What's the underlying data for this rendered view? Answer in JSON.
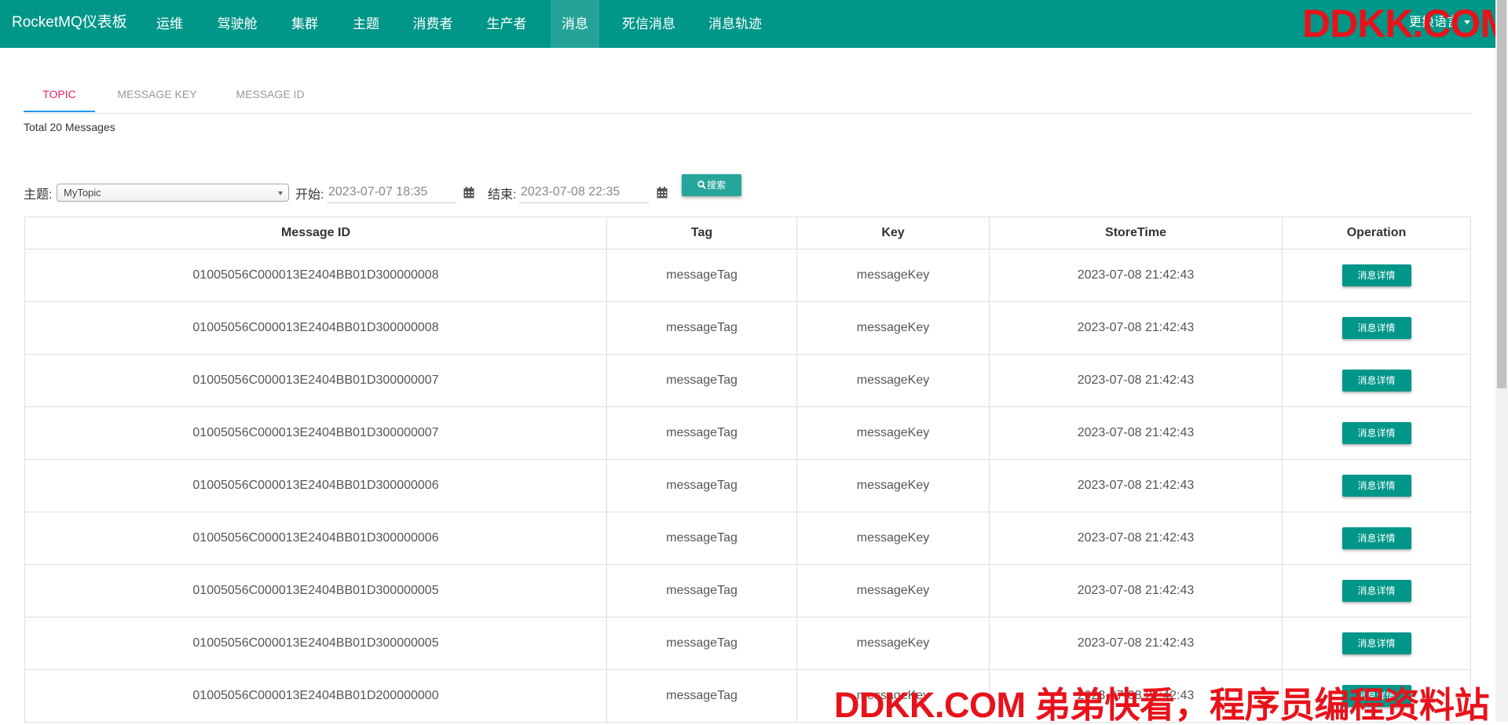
{
  "navbar": {
    "brand": "RocketMQ仪表板",
    "items": [
      {
        "label": "运维"
      },
      {
        "label": "驾驶舱"
      },
      {
        "label": "集群"
      },
      {
        "label": "主题"
      },
      {
        "label": "消费者"
      },
      {
        "label": "生产者"
      },
      {
        "label": "消息"
      },
      {
        "label": "死信消息"
      },
      {
        "label": "消息轨迹"
      }
    ],
    "active_item": "消息",
    "language_label": "更换语言"
  },
  "watermark": {
    "top": "DDKK.COM",
    "bottom": "DDKK.COM 弟弟快看，程序员编程资料站"
  },
  "tabs": [
    {
      "label": "TOPIC"
    },
    {
      "label": "MESSAGE KEY"
    },
    {
      "label": "MESSAGE ID"
    }
  ],
  "active_tab": "TOPIC",
  "total_text": "Total 20 Messages",
  "filters": {
    "topic_label": "主题:",
    "topic_value": "MyTopic",
    "start_label": "开始:",
    "start_value": "2023-07-07 18:35",
    "end_label": "结束:",
    "end_value": "2023-07-08 22:35",
    "search_label": "搜索"
  },
  "table": {
    "headers": [
      "Message ID",
      "Tag",
      "Key",
      "StoreTime",
      "Operation"
    ],
    "detail_label": "消息详情",
    "rows": [
      {
        "id": "01005056C000013E2404BB01D300000008",
        "tag": "messageTag",
        "key": "messageKey",
        "time": "2023-07-08 21:42:43"
      },
      {
        "id": "01005056C000013E2404BB01D300000008",
        "tag": "messageTag",
        "key": "messageKey",
        "time": "2023-07-08 21:42:43"
      },
      {
        "id": "01005056C000013E2404BB01D300000007",
        "tag": "messageTag",
        "key": "messageKey",
        "time": "2023-07-08 21:42:43"
      },
      {
        "id": "01005056C000013E2404BB01D300000007",
        "tag": "messageTag",
        "key": "messageKey",
        "time": "2023-07-08 21:42:43"
      },
      {
        "id": "01005056C000013E2404BB01D300000006",
        "tag": "messageTag",
        "key": "messageKey",
        "time": "2023-07-08 21:42:43"
      },
      {
        "id": "01005056C000013E2404BB01D300000006",
        "tag": "messageTag",
        "key": "messageKey",
        "time": "2023-07-08 21:42:43"
      },
      {
        "id": "01005056C000013E2404BB01D300000005",
        "tag": "messageTag",
        "key": "messageKey",
        "time": "2023-07-08 21:42:43"
      },
      {
        "id": "01005056C000013E2404BB01D300000005",
        "tag": "messageTag",
        "key": "messageKey",
        "time": "2023-07-08 21:42:43"
      },
      {
        "id": "01005056C000013E2404BB01D200000000",
        "tag": "messageTag",
        "key": "messageKey",
        "time": "2023-07-08 21:42:43"
      }
    ]
  },
  "colors": {
    "navbar": "#009688",
    "active_tab_text": "#e91e63",
    "active_tab_indicator": "#2196f3",
    "button": "#009688",
    "watermark": "#e8121b"
  }
}
